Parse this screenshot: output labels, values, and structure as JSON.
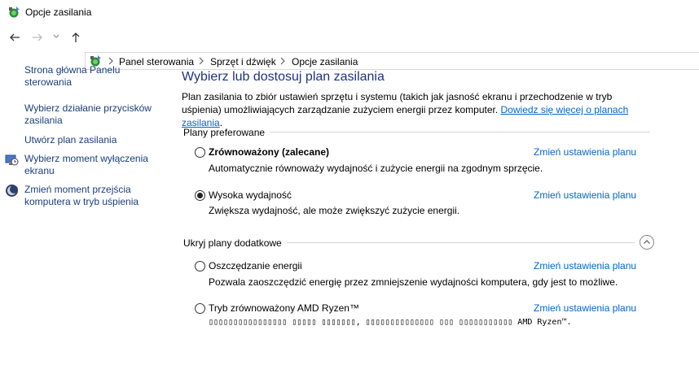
{
  "window": {
    "title": "Opcje zasilania",
    "icon": "power-options-icon"
  },
  "nav": {
    "back": "back-arrow-icon",
    "forward": "forward-arrow-icon",
    "recent": "chevron-down-icon",
    "up": "up-arrow-icon"
  },
  "breadcrumb": {
    "icon": "power-options-icon",
    "items": [
      "Panel sterowania",
      "Sprzęt i dźwięk",
      "Opcje zasilania"
    ]
  },
  "sidebar": {
    "home": "Strona główna Panelu sterowania",
    "items": [
      {
        "label": "Wybierz działanie przycisków zasilania",
        "icon": ""
      },
      {
        "label": "Utwórz plan zasilania",
        "icon": ""
      },
      {
        "label": "Wybierz moment wyłączenia ekranu",
        "icon": "monitor-clock-icon"
      },
      {
        "label": "Zmień moment przejścia komputera w tryb uśpienia",
        "icon": "moon-sleep-icon"
      }
    ]
  },
  "main": {
    "title": "Wybierz lub dostosuj plan zasilania",
    "description": "Plan zasilania to zbiór ustawień sprzętu i systemu (takich jak jasność ekranu i przechodzenie w tryb uśpienia) umożliwiających zarządzanie zużyciem energii przez komputer.",
    "learn_more": "Dowiedz się więcej o planach zasilania",
    "preferred_label": "Plany preferowane",
    "hidden_label": "Ukryj plany dodatkowe",
    "change_link": "Zmień ustawienia planu",
    "preferred_plans": [
      {
        "name": "Zrównoważony (zalecane)",
        "description": "Automatycznie równoważy wydajność i zużycie energii na zgodnym sprzęcie.",
        "selected": false,
        "bold": true
      },
      {
        "name": "Wysoka wydajność",
        "description": "Zwiększa wydajność, ale może zwiększyć zużycie energii.",
        "selected": true,
        "bold": false
      }
    ],
    "additional_plans": [
      {
        "name": "Oszczędzanie energii",
        "description": "Pozwala zaoszczędzić energię przez zmniejszenie wydajności komputera, gdy jest to możliwe.",
        "selected": false
      },
      {
        "name": "Tryb zrównoważony AMD Ryzen™",
        "description": "▯▯▯▯▯▯▯▯▯▯▯▯▯▯▯▯ ▯▯▯▯▯ ▯▯▯▯▯▯▯, ▯▯▯▯▯▯▯▯▯▯▯▯▯▯ ▯▯▯ ▯▯▯▯▯▯▯▯▯▯▯ AMD Ryzen™.",
        "selected": false
      }
    ]
  },
  "colors": {
    "link": "#0066cc",
    "title": "#1e3287",
    "sidebar_link": "#1a3e7c"
  }
}
